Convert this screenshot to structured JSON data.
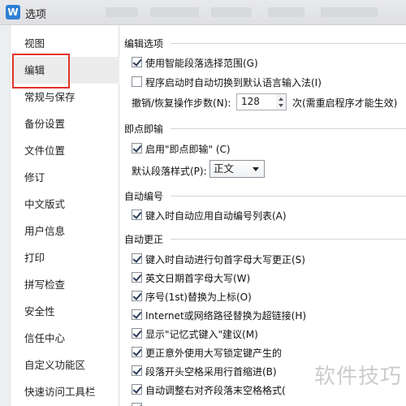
{
  "window": {
    "title": "选项",
    "app_icon_letter": "W"
  },
  "sidebar": {
    "items": [
      {
        "label": "视图"
      },
      {
        "label": "编辑"
      },
      {
        "label": "常规与保存"
      },
      {
        "label": "备份设置"
      },
      {
        "label": "文件位置"
      },
      {
        "label": "修订"
      },
      {
        "label": "中文版式"
      },
      {
        "label": "用户信息"
      },
      {
        "label": "打印"
      },
      {
        "label": "拼写检查"
      },
      {
        "label": "安全性"
      },
      {
        "label": "信任中心"
      },
      {
        "label": "自定义功能区"
      },
      {
        "label": "快速访问工具栏"
      }
    ],
    "selected_index": 1
  },
  "sections": {
    "edit_options": {
      "title": "编辑选项",
      "smart_paragraph": {
        "label": "使用智能段落选择范围(G)",
        "checked": true
      },
      "auto_ime": {
        "label": "程序启动时自动切换到默认语言输入法(I)",
        "checked": false
      },
      "undo_steps": {
        "label": "撤销/恢复操作步数(N):",
        "value": "128",
        "note": "次(需重启程序才能生效)"
      }
    },
    "click_type": {
      "title": "即点即输",
      "enable": {
        "label": "启用\"即点即输\" (C)",
        "checked": true
      },
      "default_style": {
        "label": "默认段落样式(P):",
        "value": "正文"
      }
    },
    "auto_numbering": {
      "title": "自动编号",
      "auto_list": {
        "label": "键入时自动应用自动编号列表(A)",
        "checked": true
      }
    },
    "autocorrect": {
      "title": "自动更正",
      "items": [
        {
          "label": "键入时自动进行句首字母大写更正(S)",
          "checked": true
        },
        {
          "label": "英文日期首字母大写(W)",
          "checked": true
        },
        {
          "label": "序号(1st)替换为上标(O)",
          "checked": true
        },
        {
          "label": "Internet或网络路径替换为超链接(H)",
          "checked": true
        },
        {
          "label": "显示\"记忆式键入\"建议(M)",
          "checked": true
        },
        {
          "label": "更正意外使用大写锁定键产生的",
          "checked": true
        },
        {
          "label": "段落开头空格采用行首缩进(B)",
          "checked": true
        },
        {
          "label": "自动调整右对齐段落末空格格式(",
          "checked": true
        },
        {
          "label": "",
          "checked": true
        }
      ]
    }
  },
  "watermark": "软件技巧"
}
